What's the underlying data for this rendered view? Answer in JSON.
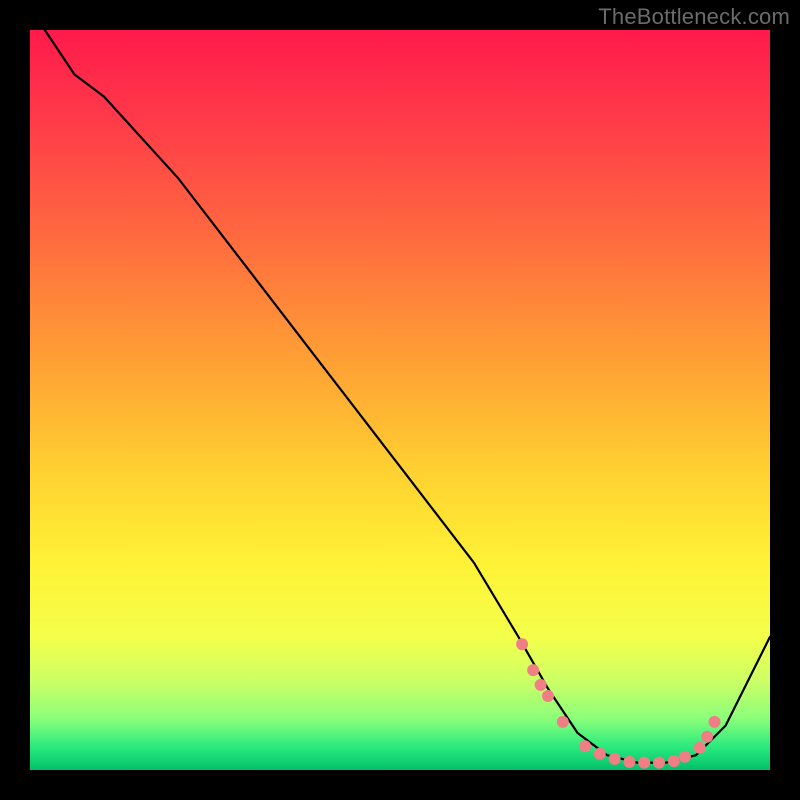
{
  "watermark": "TheBottleneck.com",
  "chart_data": {
    "type": "line",
    "title": "",
    "xlabel": "",
    "ylabel": "",
    "xlim": [
      0,
      100
    ],
    "ylim": [
      0,
      100
    ],
    "series": [
      {
        "name": "curve",
        "x": [
          2,
          6,
          10,
          20,
          30,
          40,
          50,
          60,
          66,
          70,
          74,
          78,
          82,
          86,
          90,
          94,
          100
        ],
        "y": [
          100,
          94,
          91,
          80,
          67,
          54,
          41,
          28,
          18,
          11,
          5,
          2,
          1,
          1,
          2,
          6,
          18
        ]
      }
    ],
    "markers": {
      "name": "dots",
      "x": [
        66.5,
        68,
        69,
        70,
        72,
        75,
        77,
        79,
        81,
        83,
        85,
        87,
        88.5,
        90.5,
        91.5,
        92.5
      ],
      "y": [
        17,
        13.5,
        11.5,
        10,
        6.5,
        3.2,
        2.2,
        1.5,
        1.1,
        1.0,
        1.0,
        1.2,
        1.8,
        3.0,
        4.5,
        6.5
      ]
    },
    "gradient_stops": [
      {
        "pct": 0,
        "color": "#ff1a4b"
      },
      {
        "pct": 12,
        "color": "#ff3a49"
      },
      {
        "pct": 28,
        "color": "#ff6a3f"
      },
      {
        "pct": 45,
        "color": "#ffa134"
      },
      {
        "pct": 60,
        "color": "#ffd231"
      },
      {
        "pct": 72,
        "color": "#fff236"
      },
      {
        "pct": 82,
        "color": "#f4ff4a"
      },
      {
        "pct": 88,
        "color": "#ccff66"
      },
      {
        "pct": 93,
        "color": "#8cff7a"
      },
      {
        "pct": 97,
        "color": "#27e97e"
      },
      {
        "pct": 100,
        "color": "#03c06a"
      }
    ]
  },
  "colors": {
    "frame": "#000000",
    "dot": "#f07f85",
    "curve": "#000000",
    "watermark": "#6b6b6b"
  }
}
